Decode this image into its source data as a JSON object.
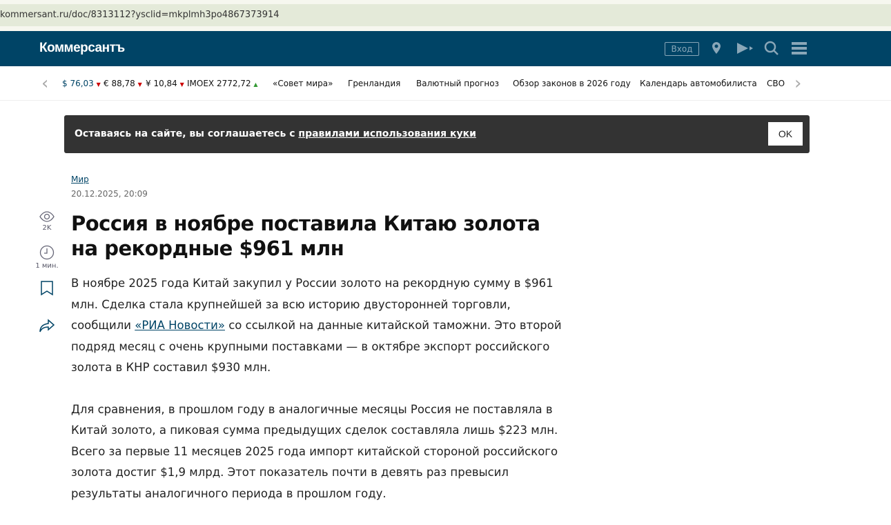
{
  "browser": {
    "url": "kommersant.ru/doc/8313112?ysclid=mkplmh3po4867373914"
  },
  "header": {
    "logo": "Коммерсантъ",
    "login": "Вход"
  },
  "ticker": {
    "rates": [
      {
        "label": "$ 76,03",
        "dir": "down"
      },
      {
        "label": "€ 88,78",
        "dir": "down"
      },
      {
        "label": "¥ 10,84",
        "dir": "down"
      },
      {
        "label": "IMOEX 2772,72",
        "dir": "up"
      }
    ],
    "links": [
      "«Совет мира»",
      "Гренландия",
      "Валютный прогноз",
      "Обзор законов в 2026 году",
      "Календарь автомобилиста",
      "СВО"
    ]
  },
  "cookie": {
    "text": "Оставаясь на сайте, вы соглашаетесь с ",
    "link": "правилами использования куки",
    "ok": "OK"
  },
  "article": {
    "rubric": "Мир",
    "date": "20.12.2025, 20:09",
    "title": "Россия в ноябре поставила Китаю золота на рекордные $961 млн",
    "views": "2K",
    "read_time": "1 мин.",
    "p1_a": "В ноябре 2025 года Китай закупил у России золото на рекордную сумму в $961 млн. Сделка стала крупнейшей за всю историю двусторонней торговли, сообщили ",
    "p1_link": "«РИА Новости»",
    "p1_b": " со ссылкой на данные китайской таможни. Это второй подряд месяц с очень крупными поставками — в октябре экспорт российского золота в КНР составил $930 млн.",
    "p2": "Для сравнения, в прошлом году в аналогичные месяцы Россия не поставляла в Китай золото, а пиковая сумма предыдущих сделок составляла лишь $223 млн. Всего за первые 11 месяцев 2025 года импорт китайской стороной российского золота достиг $1,9 млрд. Этот показатель почти в девять раз превысил результаты аналогичного периода в прошлом году."
  }
}
